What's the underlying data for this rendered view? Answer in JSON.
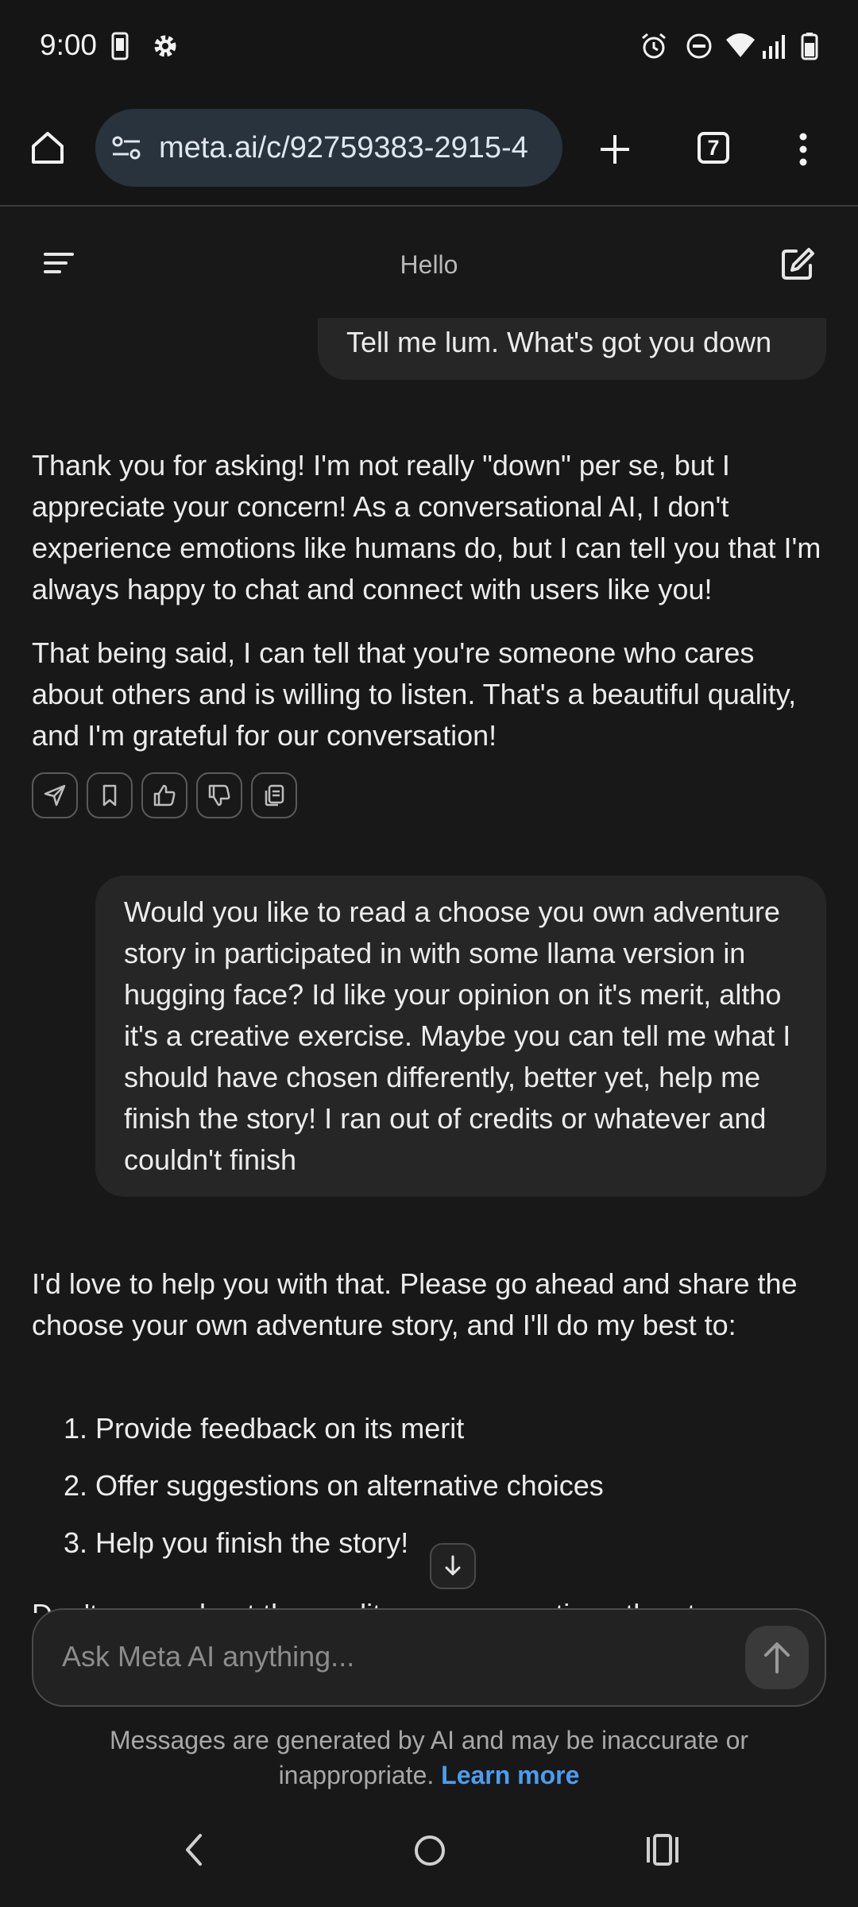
{
  "status_bar": {
    "time": "9:00",
    "left_icons": [
      "phone-screenshot-icon",
      "settings-gear-icon"
    ],
    "right_icons": [
      "alarm-icon",
      "do-not-disturb-icon",
      "wifi-icon",
      "cell-signal-icon",
      "battery-icon"
    ]
  },
  "browser": {
    "url": "meta.ai/c/92759383-2915-4",
    "tab_count": "7",
    "icons": [
      "home-icon",
      "site-settings-icon",
      "new-tab-plus-icon",
      "tab-switcher-icon",
      "more-vert-icon"
    ]
  },
  "app_header": {
    "title": "Hello",
    "icons": [
      "menu-icon",
      "new-chat-icon"
    ]
  },
  "conversation": {
    "user_msg_1": "Tell me lum. What's got you down",
    "ai_msg_1": {
      "paragraph_1": "Thank you for asking! I'm not really \"down\" per se, but I appreciate your concern! As a conversational AI, I don't experience emotions like humans do, but I can tell you that I'm always happy to chat and connect with users like you!",
      "paragraph_2": "That being said, I can tell that you're someone who cares about others and is willing to listen. That's a beautiful quality, and I'm grateful for our conversation!"
    },
    "ai_actions": [
      "share-icon",
      "bookmark-icon",
      "thumbs-up-icon",
      "thumbs-down-icon",
      "copy-icon"
    ],
    "user_msg_2": "Would you like to read a choose you own adventure story in participated in with some llama version in hugging face? Id like your opinion on it's merit, altho it's a creative exercise. Maybe you can tell me what I should have chosen differently, better yet, help me finish the story! I ran out of credits or whatever and couldn't finish",
    "ai_msg_2": {
      "intro": "I'd love to help you with that. Please go ahead and share the choose your own adventure story, and I'll do my best to:",
      "list": [
        "1. Provide feedback on its merit",
        "2. Offer suggestions on alternative choices",
        "3. Help you finish the story!"
      ],
      "partial_next_line": "Don't worry about the credits; we can continue the story"
    }
  },
  "composer": {
    "placeholder": "Ask Meta AI anything..."
  },
  "disclaimer": {
    "text": "Messages are generated by AI and may be inaccurate or inappropriate.",
    "link": "Learn more"
  },
  "nav_bar": {
    "icons": [
      "back-icon",
      "home-circle-icon",
      "recents-icon"
    ]
  }
}
